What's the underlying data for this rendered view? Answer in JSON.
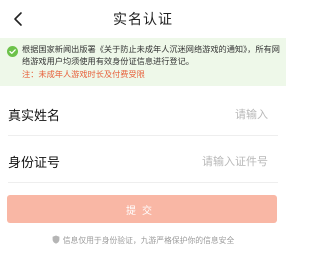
{
  "header": {
    "title": "实名认证",
    "back_icon": "chevron-left-icon"
  },
  "notice": {
    "icon": "check-circle-icon",
    "icon_color": "#6cc24a",
    "text": "根据国家新闻出版署《关于防止未成年人沉迷网络游戏的通知》，所有网络游戏用户均须使用有效身份证信息进行登记。",
    "warning": "注：未成年人游戏时长及付费受限",
    "background": "#eef8e9",
    "warning_color": "#e8613c"
  },
  "form": {
    "name": {
      "label": "真实姓名",
      "placeholder": "请输入",
      "value": ""
    },
    "id_number": {
      "label": "身份证号",
      "placeholder": "请输入证件号",
      "value": ""
    }
  },
  "submit": {
    "label": "提交",
    "color": "#f9b7a5"
  },
  "footer": {
    "icon": "shield-icon",
    "text": "信息仅用于身份验证，九游严格保护你的信息安全"
  }
}
